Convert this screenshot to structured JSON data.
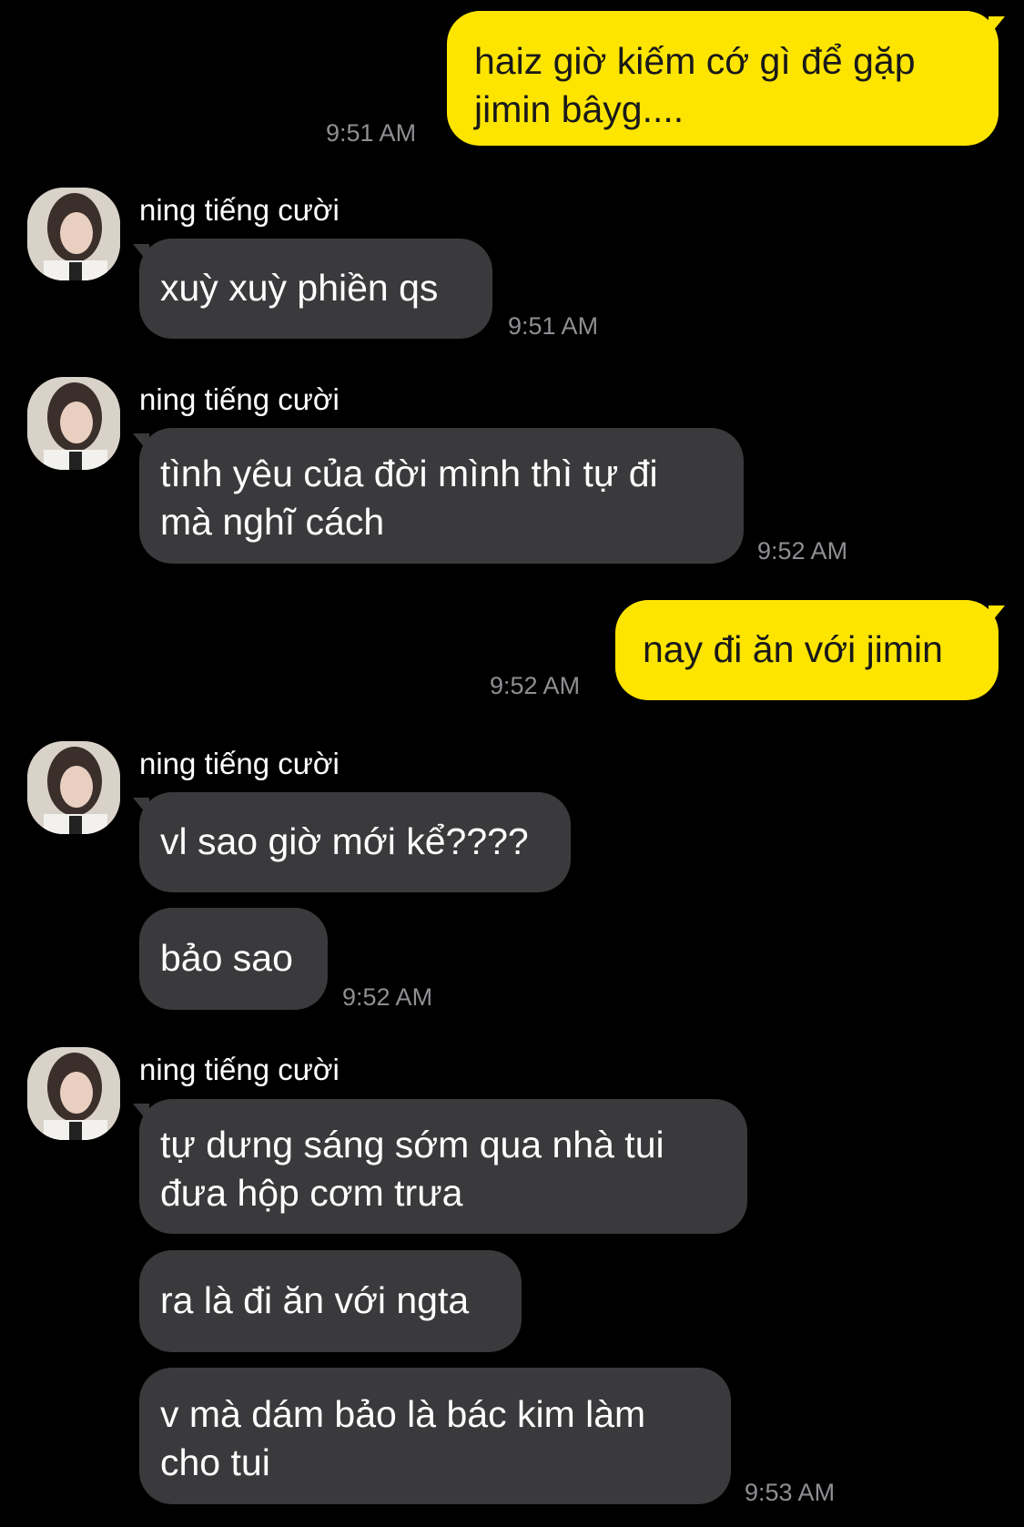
{
  "messages": [
    {
      "side": "me",
      "text": "haiz giờ kiếm cớ gì để gặp\njimin bâyg....",
      "time": "9:51 AM"
    },
    {
      "side": "them",
      "sender": "ning tiếng cười",
      "text": "xuỳ xuỳ phiền qs",
      "time": "9:51 AM"
    },
    {
      "side": "them",
      "sender": "ning tiếng cười",
      "text": "tình yêu của đời mình thì tự đi\nmà nghĩ cách",
      "time": "9:52 AM"
    },
    {
      "side": "me",
      "text": "nay đi ăn với jimin",
      "time": "9:52 AM"
    },
    {
      "side": "them",
      "sender": "ning tiếng cười",
      "text": "vl sao giờ mới kể????"
    },
    {
      "side": "them",
      "text": "bảo sao",
      "time": "9:52 AM"
    },
    {
      "side": "them",
      "sender": "ning tiếng cười",
      "text": "tự dưng sáng sớm qua nhà tui\nđưa hộp cơm trưa"
    },
    {
      "side": "them",
      "text": "ra là đi ăn với ngta"
    },
    {
      "side": "them",
      "text": "v mà dám bảo là bác kim làm\ncho tui",
      "time": "9:53 AM"
    }
  ],
  "colors": {
    "background": "#000000",
    "my_bubble": "#fee500",
    "their_bubble": "#3a3a3c",
    "timestamp": "#8e8e93"
  }
}
